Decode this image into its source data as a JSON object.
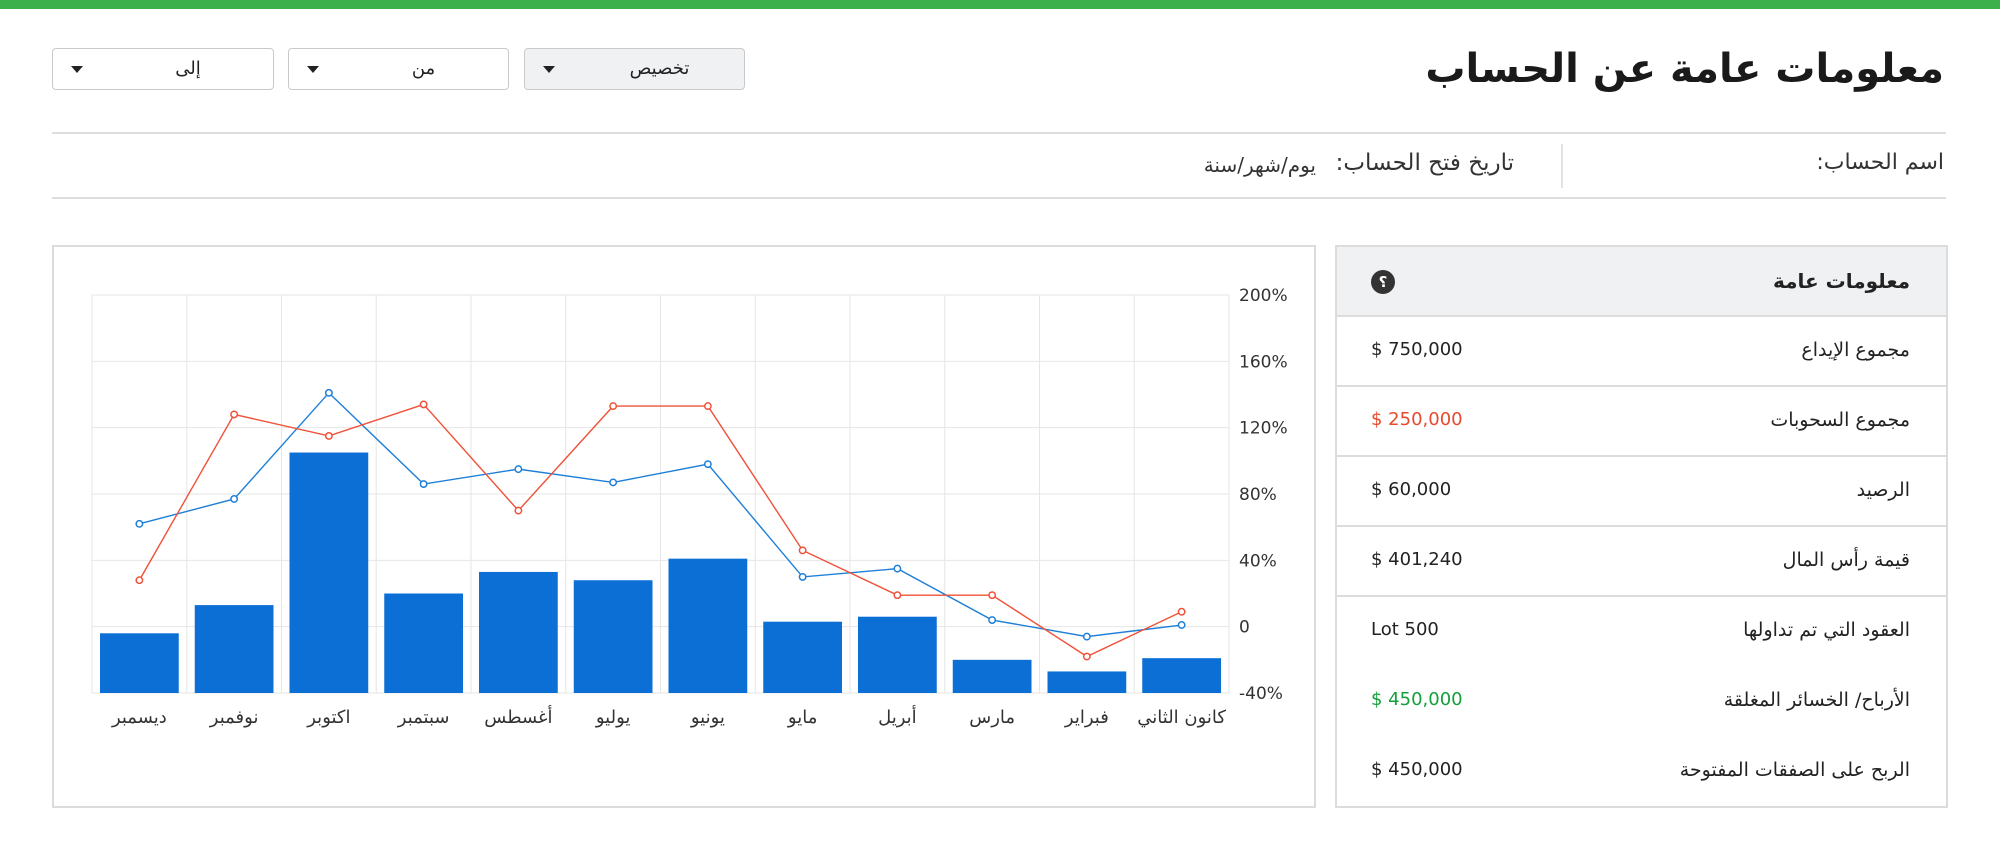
{
  "colors": {
    "accent_bar": "#3cb04a",
    "bar_fill": "#0b6fd6",
    "line_blue": "#1e7fd8",
    "line_red": "#f05138",
    "negative": "#e8492c",
    "positive": "#14a03b"
  },
  "header": {
    "title": "معلومات عامة عن الحساب",
    "filters": {
      "custom_label": "تخصيص",
      "from_label": "من",
      "to_label": "إلى"
    }
  },
  "account": {
    "name_label": "اسم الحساب:",
    "open_date_label": "تاريخ فتح الحساب:",
    "open_date_value": "يوم/شهر/سنة"
  },
  "summary": {
    "title": "معلومات عامة",
    "help_icon": "question-circle-icon",
    "rows": [
      {
        "label": "مجموع الإيداع",
        "value": "$ 750,000",
        "color": "#222222"
      },
      {
        "label": "مجموع السحوبات",
        "value": "$ 250,000",
        "color": "#e8492c"
      },
      {
        "label": "الرصيد",
        "value": "$ 60,000",
        "color": "#222222"
      },
      {
        "label": "قيمة رأس المال",
        "value": "$ 401,240",
        "color": "#222222"
      },
      {
        "label": "العقود التي تم تداولها",
        "value": "Lot 500",
        "color": "#222222"
      },
      {
        "label": "الأرباح/ الخسائر المغلقة",
        "value": "$ 450,000",
        "color": "#14a03b"
      },
      {
        "label": "الربح على الصفقات المفتوحة",
        "value": "$ 450,000",
        "color": "#222222"
      }
    ]
  },
  "chart_data": {
    "type": "bar",
    "categories": [
      "ديسمبر",
      "نوفمبر",
      "اكتوبر",
      "سبتمبر",
      "أغسطس",
      "يوليو",
      "يونيو",
      "مايو",
      "أبريل",
      "مارس",
      "فبراير",
      "كانون الثاني"
    ],
    "yticks": [
      "200%",
      "160%",
      "120%",
      "80%",
      "40%",
      "0",
      "-40%"
    ],
    "ylim": [
      -40,
      200
    ],
    "y_axis_side": "right",
    "grid": true,
    "series": [
      {
        "kind": "bar",
        "values": [
          -4,
          13,
          105,
          20,
          33,
          28,
          41,
          3,
          6,
          -20,
          -27,
          -19
        ]
      },
      {
        "kind": "line",
        "values": [
          62,
          77,
          141,
          86,
          95,
          87,
          98,
          30,
          35,
          4,
          -6,
          1
        ]
      },
      {
        "kind": "line",
        "values": [
          28,
          128,
          115,
          134,
          70,
          133,
          133,
          46,
          19,
          19,
          -18,
          9
        ]
      }
    ]
  }
}
